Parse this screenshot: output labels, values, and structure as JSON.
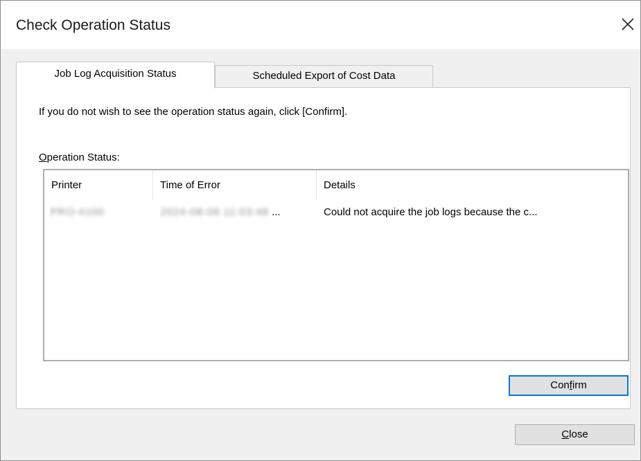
{
  "window": {
    "title": "Check Operation Status",
    "close_icon": "close-icon"
  },
  "tabs": [
    {
      "label": "Job Log Acquisition Status",
      "active": true
    },
    {
      "label": "Scheduled Export of Cost Data",
      "active": false
    }
  ],
  "panel": {
    "info_text": "If you do not wish to see the operation status again, click [Confirm].",
    "operation_status_label_first": "O",
    "operation_status_label_rest": "peration Status:",
    "columns": [
      "Printer",
      "Time of Error",
      "Details"
    ],
    "rows": [
      {
        "printer": "PRO-4100",
        "time_of_error": "2024-08-06 11:03:48",
        "details": "Could not acquire the job logs because the c..."
      }
    ],
    "confirm_button": {
      "pre": "Con",
      "accel": "f",
      "post": "irm"
    }
  },
  "close_button": {
    "accel": "C",
    "post": "lose"
  },
  "colors": {
    "dialog_bg": "#f0f0f0",
    "titlebar_bg": "#ffffff",
    "button_bg": "#e1e1e1",
    "focus_border": "#0078d7"
  }
}
